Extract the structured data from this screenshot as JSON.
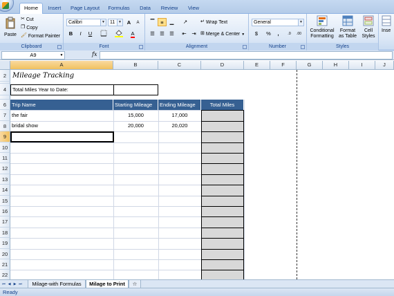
{
  "ribbon_tabs": [
    "Home",
    "Insert",
    "Page Layout",
    "Formulas",
    "Data",
    "Review",
    "View"
  ],
  "clipboard": {
    "paste": "Paste",
    "cut": "Cut",
    "copy": "Copy",
    "format_painter": "Format Painter",
    "group": "Clipboard"
  },
  "font": {
    "name": "Calibri",
    "size": "11",
    "bold": "B",
    "italic": "I",
    "underline": "U",
    "grow": "A",
    "shrink": "A",
    "group": "Font"
  },
  "alignment": {
    "wrap_text": "Wrap Text",
    "merge_center": "Merge & Center",
    "group": "Alignment"
  },
  "number": {
    "format": "General",
    "currency": "$",
    "percent": "%",
    "comma": ",",
    "inc_dec": ".0",
    "dec_dec": ".00",
    "group": "Number"
  },
  "styles": {
    "conditional": "Conditional",
    "conditional2": "Formatting",
    "format_as": "Format",
    "format_as2": "as Table",
    "cell": "Cell",
    "cell2": "Styles",
    "group": "Styles"
  },
  "cells_group": {
    "insert": "Inse"
  },
  "formula_bar": {
    "name_box": "A9",
    "fx": "fx",
    "value": ""
  },
  "columns": [
    "A",
    "B",
    "C",
    "D",
    "E",
    "F",
    "G",
    "H",
    "I",
    "J"
  ],
  "rows": [
    "2",
    "4",
    "6",
    "7",
    "8",
    "9",
    "10",
    "11",
    "12",
    "13",
    "14",
    "15",
    "16",
    "17",
    "18",
    "19",
    "20",
    "21",
    "22"
  ],
  "sheet": {
    "title": "Mileage Tracking",
    "total_label": "Total Miles Year to Date:",
    "headers": [
      "Trip Name",
      "Starting Mileage",
      "Ending Mileage",
      "Total Miles"
    ],
    "records": [
      {
        "trip": "the fair",
        "start": "15,000",
        "end": "17,000"
      },
      {
        "trip": "bridal show",
        "start": "20,000",
        "end": "20,020"
      }
    ]
  },
  "sheet_tabs": [
    "Milage-with Formulas",
    "Milage to Print"
  ],
  "active_sheet": "Milage to Print",
  "status": "Ready",
  "colors": {
    "header_fill": "#366092",
    "total_fill": "#d8d8d8",
    "ribbon": "#dbe7f6",
    "selected_header": "#f1c15f"
  }
}
